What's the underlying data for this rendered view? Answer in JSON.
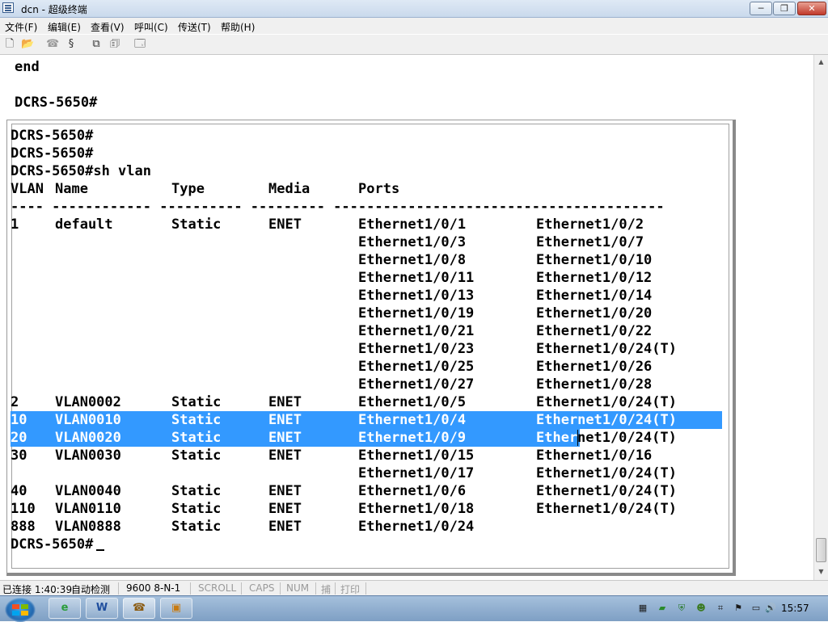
{
  "window": {
    "title": "dcn - 超级终端",
    "min": "─",
    "max": "❐",
    "close": "✕"
  },
  "menu": [
    "文件(F)",
    "编辑(E)",
    "查看(V)",
    "呼叫(C)",
    "传送(T)",
    "帮助(H)"
  ],
  "toolbar": [
    {
      "name": "new-file-icon",
      "glyph": "🗋"
    },
    {
      "name": "open-folder-icon",
      "glyph": "📂"
    },
    {
      "name": "phone-icon",
      "glyph": "☎"
    },
    {
      "name": "disconnect-icon",
      "glyph": "§"
    },
    {
      "name": "send-icon",
      "glyph": "⧉"
    },
    {
      "name": "receive-icon",
      "glyph": "🗊"
    },
    {
      "name": "properties-icon",
      "glyph": "🗔"
    }
  ],
  "background_lines": [
    "end",
    "",
    "DCRS-5650#"
  ],
  "terminal": {
    "prompt_lines": [
      "DCRS-5650#",
      "DCRS-5650#",
      "DCRS-5650#sh vlan"
    ],
    "header": {
      "vlan": "VLAN",
      "name": "Name",
      "type": "Type",
      "media": "Media",
      "ports": "Ports"
    },
    "separator": "---- ------------ ---------- --------- ----------------------------------------",
    "rows": [
      {
        "vlan": "1",
        "name": "default",
        "type": "Static",
        "media": "ENET",
        "p1": "Ethernet1/0/1",
        "p2": "Ethernet1/0/2"
      },
      {
        "vlan": "",
        "name": "",
        "type": "",
        "media": "",
        "p1": "Ethernet1/0/3",
        "p2": "Ethernet1/0/7"
      },
      {
        "vlan": "",
        "name": "",
        "type": "",
        "media": "",
        "p1": "Ethernet1/0/8",
        "p2": "Ethernet1/0/10"
      },
      {
        "vlan": "",
        "name": "",
        "type": "",
        "media": "",
        "p1": "Ethernet1/0/11",
        "p2": "Ethernet1/0/12"
      },
      {
        "vlan": "",
        "name": "",
        "type": "",
        "media": "",
        "p1": "Ethernet1/0/13",
        "p2": "Ethernet1/0/14"
      },
      {
        "vlan": "",
        "name": "",
        "type": "",
        "media": "",
        "p1": "Ethernet1/0/19",
        "p2": "Ethernet1/0/20"
      },
      {
        "vlan": "",
        "name": "",
        "type": "",
        "media": "",
        "p1": "Ethernet1/0/21",
        "p2": "Ethernet1/0/22"
      },
      {
        "vlan": "",
        "name": "",
        "type": "",
        "media": "",
        "p1": "Ethernet1/0/23",
        "p2": "Ethernet1/0/24(T)"
      },
      {
        "vlan": "",
        "name": "",
        "type": "",
        "media": "",
        "p1": "Ethernet1/0/25",
        "p2": "Ethernet1/0/26"
      },
      {
        "vlan": "",
        "name": "",
        "type": "",
        "media": "",
        "p1": "Ethernet1/0/27",
        "p2": "Ethernet1/0/28"
      },
      {
        "vlan": "2",
        "name": "VLAN0002",
        "type": "Static",
        "media": "ENET",
        "p1": "Ethernet1/0/5",
        "p2": "Ethernet1/0/24(T)"
      },
      {
        "vlan": "10",
        "name": "VLAN0010",
        "type": "Static",
        "media": "ENET",
        "p1": "Ethernet1/0/4",
        "p2": "Ethernet1/0/24(T)",
        "hl": "full"
      },
      {
        "vlan": "20",
        "name": "VLAN0020",
        "type": "Static",
        "media": "ENET",
        "p1": "Ethernet1/0/9",
        "p2a": "Ether",
        "p2b": "net1/0/24(T)",
        "hl": "partial"
      },
      {
        "vlan": "30",
        "name": "VLAN0030",
        "type": "Static",
        "media": "ENET",
        "p1": "Ethernet1/0/15",
        "p2": "Ethernet1/0/16"
      },
      {
        "vlan": "",
        "name": "",
        "type": "",
        "media": "",
        "p1": "Ethernet1/0/17",
        "p2": "Ethernet1/0/24(T)"
      },
      {
        "vlan": "40",
        "name": "VLAN0040",
        "type": "Static",
        "media": "ENET",
        "p1": "Ethernet1/0/6",
        "p2": "Ethernet1/0/24(T)"
      },
      {
        "vlan": "110",
        "name": "VLAN0110",
        "type": "Static",
        "media": "ENET",
        "p1": "Ethernet1/0/18",
        "p2": "Ethernet1/0/24(T)"
      },
      {
        "vlan": "888",
        "name": "VLAN0888",
        "type": "Static",
        "media": "ENET",
        "p1": "Ethernet1/0/24",
        "p2": ""
      }
    ],
    "final_prompt": "DCRS-5650#"
  },
  "status": {
    "connected": "已连接 1:40:39",
    "detect": "自动检测",
    "baud": "9600 8-N-1",
    "scroll": "SCROLL",
    "caps": "CAPS",
    "num": "NUM",
    "capture": "捕",
    "print": "打印"
  },
  "taskbar": {
    "apps": [
      {
        "name": "ie-taskbar-icon",
        "glyph": "e"
      },
      {
        "name": "word-taskbar-icon",
        "glyph": "W"
      },
      {
        "name": "hyperterminal-taskbar-icon",
        "glyph": "☎"
      },
      {
        "name": "window-taskbar-icon",
        "glyph": "▣"
      }
    ],
    "tray": [
      {
        "name": "film-icon",
        "glyph": "▦"
      },
      {
        "name": "network-icon",
        "glyph": "▰"
      },
      {
        "name": "shield-icon",
        "glyph": "⛨"
      },
      {
        "name": "people-icon",
        "glyph": "☻"
      },
      {
        "name": "device-icon",
        "glyph": "⌗"
      },
      {
        "name": "flag-icon",
        "glyph": "⚑"
      },
      {
        "name": "battery-icon",
        "glyph": "▭"
      },
      {
        "name": "volume-icon",
        "glyph": "🔊"
      }
    ],
    "clock": "15:57"
  }
}
